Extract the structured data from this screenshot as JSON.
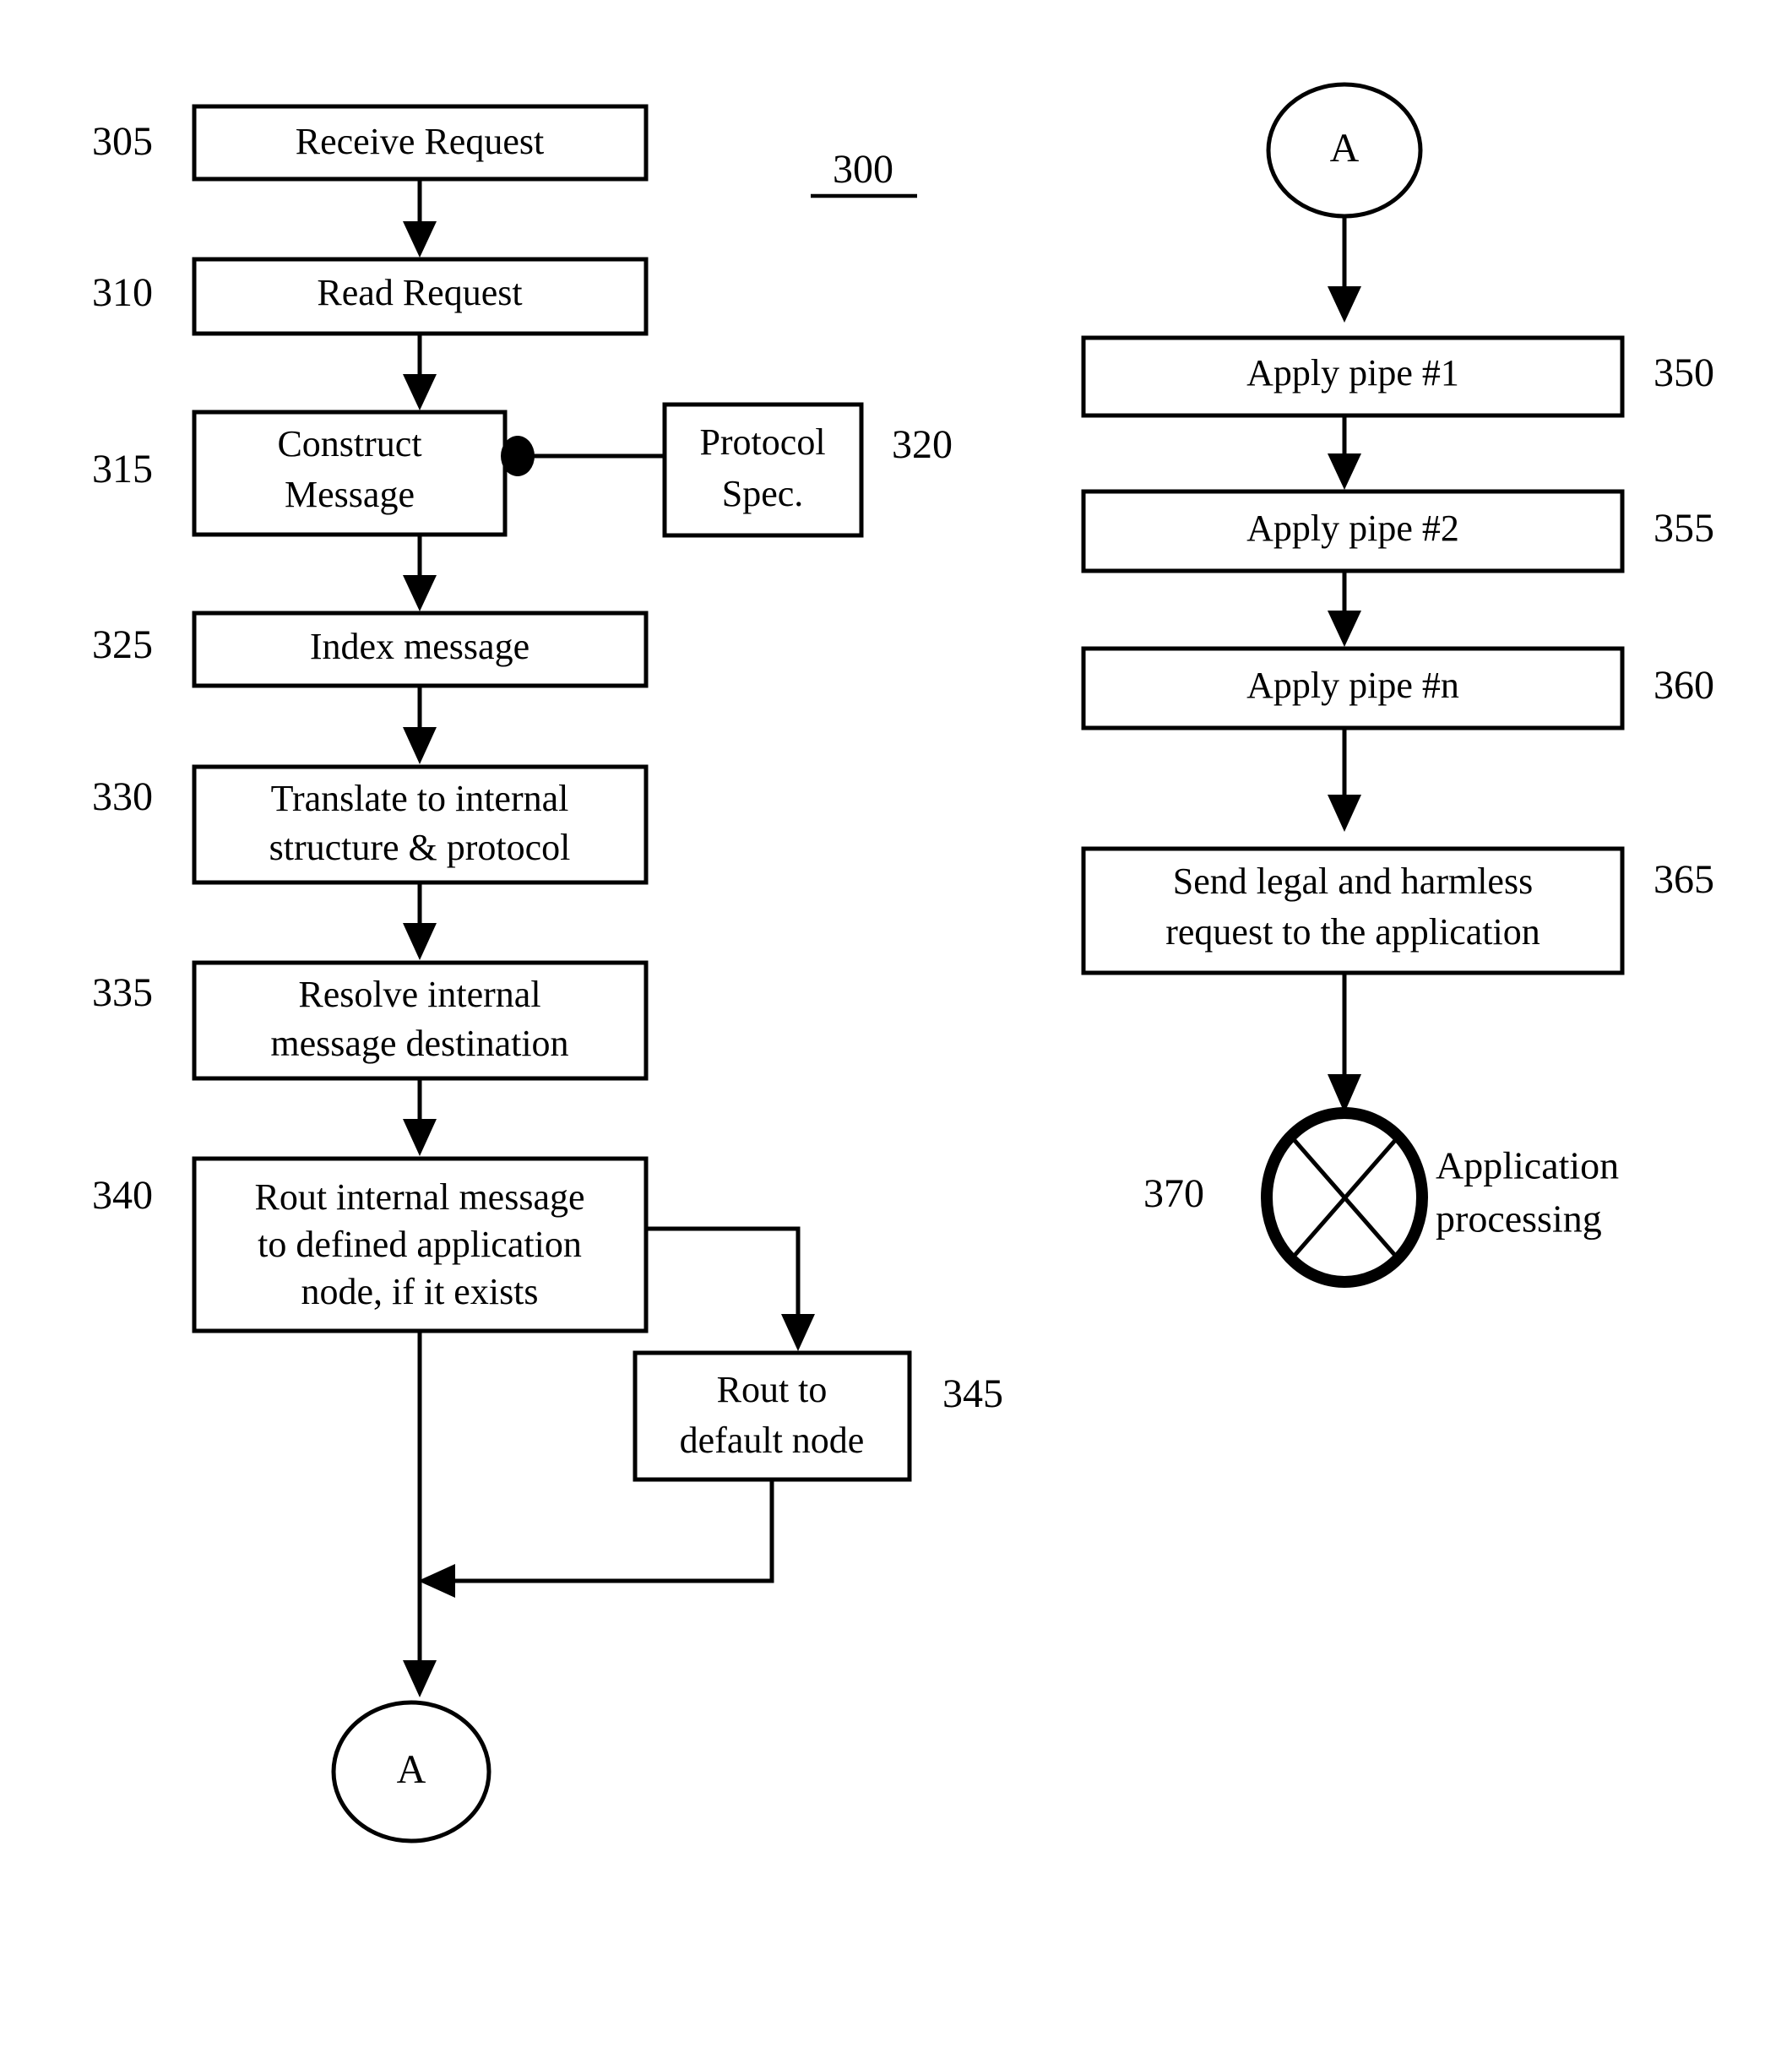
{
  "figure": {
    "number": "300",
    "underlined": true
  },
  "left_column": {
    "steps": [
      {
        "ref": "305",
        "lines": [
          "Receive Request"
        ]
      },
      {
        "ref": "310",
        "lines": [
          "Read Request"
        ]
      },
      {
        "ref": "315",
        "lines": [
          "Construct",
          "Message"
        ]
      },
      {
        "ref": "325",
        "lines": [
          "Index message"
        ]
      },
      {
        "ref": "330",
        "lines": [
          "Translate to internal",
          "structure & protocol"
        ]
      },
      {
        "ref": "335",
        "lines": [
          "Resolve internal",
          "message destination"
        ]
      },
      {
        "ref": "340",
        "lines": [
          "Rout internal message",
          "to defined application",
          "node, if it exists"
        ]
      }
    ],
    "side_box": {
      "ref": "320",
      "lines": [
        "Protocol",
        "Spec."
      ]
    },
    "branch_box": {
      "ref": "345",
      "lines": [
        "Rout to",
        "default node"
      ]
    },
    "exit_connector": {
      "label": "A"
    }
  },
  "right_column": {
    "entry_connector": {
      "label": "A"
    },
    "steps": [
      {
        "ref": "350",
        "lines": [
          "Apply pipe #1"
        ]
      },
      {
        "ref": "355",
        "lines": [
          "Apply pipe #2"
        ]
      },
      {
        "ref": "360",
        "lines": [
          "Apply pipe #n"
        ]
      },
      {
        "ref": "365",
        "lines": [
          "Send legal and harmless",
          "request to the application"
        ]
      }
    ],
    "terminal": {
      "ref": "370",
      "label_lines": [
        "Application",
        "processing"
      ],
      "shape": "crossed-circle"
    }
  },
  "colors": {
    "ink": "#000000",
    "paper": "#ffffff"
  }
}
